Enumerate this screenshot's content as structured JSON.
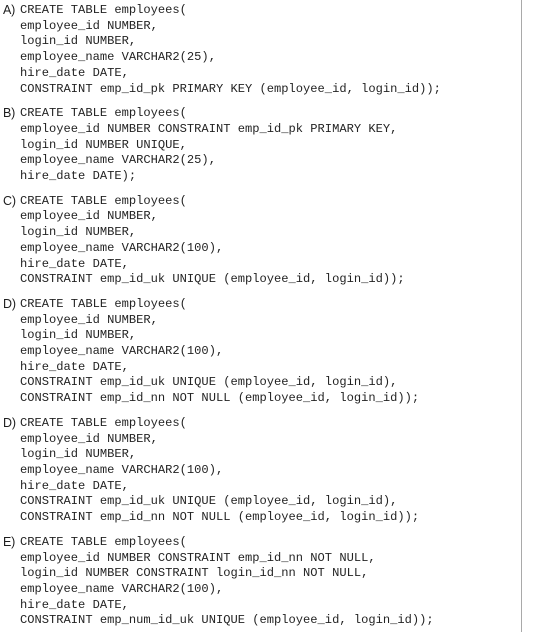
{
  "document": {
    "type": "multiple-choice-answer-options",
    "background_color": "#ffffff",
    "text_color": "#232323",
    "rule_color": "#9a9a9a",
    "options": [
      {
        "label": "A)",
        "lines": [
          "CREATE TABLE employees(",
          "employee_id NUMBER,",
          "login_id NUMBER,",
          "employee_name VARCHAR2(25),",
          "hire_date DATE,",
          "CONSTRAINT emp_id_pk PRIMARY KEY (employee_id, login_id));"
        ]
      },
      {
        "label": "B)",
        "lines": [
          "CREATE TABLE employees(",
          "employee_id NUMBER CONSTRAINT emp_id_pk PRIMARY KEY,",
          "login_id NUMBER UNIQUE,",
          "employee_name VARCHAR2(25),",
          "hire_date DATE);"
        ]
      },
      {
        "label": "C)",
        "lines": [
          "CREATE TABLE employees(",
          "employee_id NUMBER,",
          "login_id NUMBER,",
          "employee_name VARCHAR2(100),",
          "hire_date DATE,",
          "CONSTRAINT emp_id_uk UNIQUE (employee_id, login_id));"
        ]
      },
      {
        "label": "D)",
        "lines": [
          "CREATE TABLE employees(",
          "employee_id NUMBER,",
          "login_id NUMBER,",
          "employee_name VARCHAR2(100),",
          "hire_date DATE,",
          "CONSTRAINT emp_id_uk UNIQUE (employee_id, login_id),",
          "CONSTRAINT emp_id_nn NOT NULL (employee_id, login_id));"
        ]
      },
      {
        "label": "D)",
        "lines": [
          "CREATE TABLE employees(",
          "employee_id NUMBER,",
          "login_id NUMBER,",
          "employee_name VARCHAR2(100),",
          "hire_date DATE,",
          "CONSTRAINT emp_id_uk UNIQUE (employee_id, login_id),",
          "CONSTRAINT emp_id_nn NOT NULL (employee_id, login_id));"
        ]
      },
      {
        "label": "E)",
        "lines": [
          "CREATE TABLE employees(",
          "employee_id NUMBER CONSTRAINT emp_id_nn NOT NULL,",
          "login_id NUMBER CONSTRAINT login_id_nn NOT NULL,",
          "employee_name VARCHAR2(100),",
          "hire_date DATE,",
          "CONSTRAINT emp_num_id_uk UNIQUE (employee_id, login_id));"
        ]
      }
    ]
  }
}
